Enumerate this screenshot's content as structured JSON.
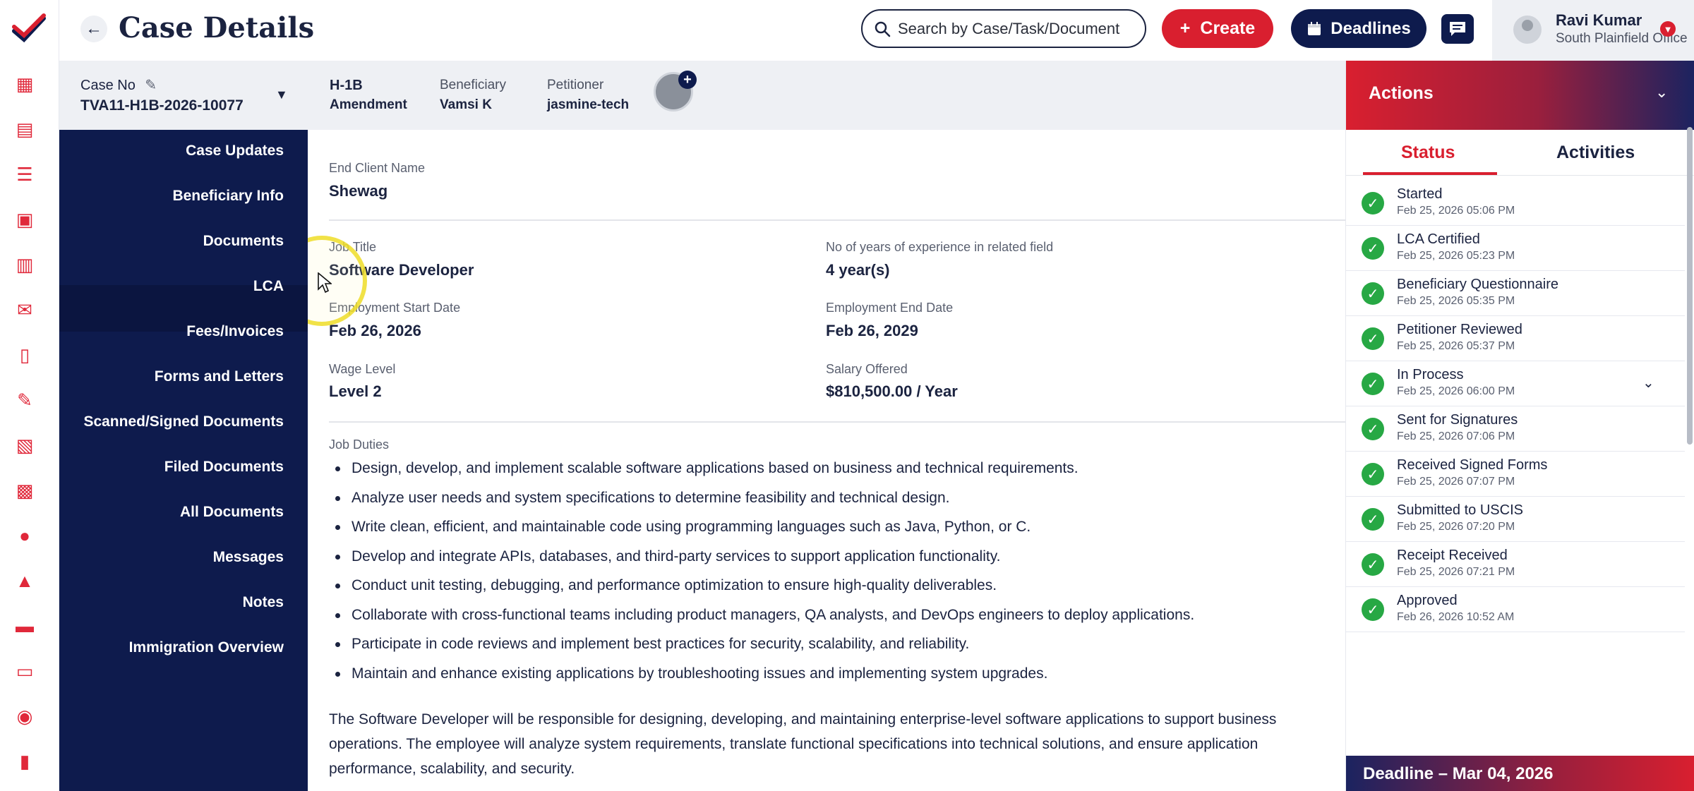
{
  "header": {
    "back_icon": "arrow-left-icon",
    "title": "Case Details",
    "search_placeholder": "Search by Case/Task/Document",
    "create_label": "Create",
    "deadlines_label": "Deadlines",
    "user_name": "Ravi Kumar",
    "user_office": "South Plainfield Office"
  },
  "rail": {
    "icons": [
      "dashboard-icon",
      "cases-icon",
      "tasks-icon",
      "calendar-icon",
      "forms-icon",
      "messages-icon",
      "documents-icon",
      "edit-icon",
      "reports-icon",
      "clipboard-icon",
      "user-icon",
      "people-icon",
      "folder-icon",
      "notes-icon",
      "contacts-icon",
      "book-icon"
    ]
  },
  "case": {
    "case_no_label": "Case No",
    "case_no": "TVA11-H1B-2026-10077",
    "visa_type": "H-1B",
    "case_type": "Amendment",
    "beneficiary_label": "Beneficiary",
    "beneficiary": "Vamsi K",
    "petitioner_label": "Petitioner",
    "petitioner": "jasmine-tech"
  },
  "subnav": {
    "items": [
      "Case Updates",
      "Beneficiary Info",
      "Documents",
      "LCA",
      "Fees/Invoices",
      "Forms and Letters",
      "Scanned/Signed Documents",
      "Filed Documents",
      "All Documents",
      "Messages",
      "Notes",
      "Immigration Overview"
    ],
    "active": "LCA"
  },
  "details": {
    "end_client_label": "End Client Name",
    "end_client": "Shewag",
    "job_title_label": "Job Title",
    "job_title": "Software Developer",
    "experience_label": "No of years of experience in related field",
    "experience": "4 year(s)",
    "start_label": "Employment Start Date",
    "start": "Feb 26, 2026",
    "end_label": "Employment End Date",
    "end": "Feb 26, 2029",
    "wage_label": "Wage Level",
    "wage": "Level 2",
    "salary_label": "Salary Offered",
    "salary": "$810,500.00 / Year",
    "duties_label": "Job Duties",
    "duties": [
      "Design, develop, and implement scalable software applications based on business and technical requirements.",
      "Analyze user needs and system specifications to determine feasibility and technical design.",
      "Write clean, efficient, and maintainable code using programming languages such as Java, Python, or C.",
      "Develop and integrate APIs, databases, and third-party services to support application functionality.",
      "Conduct unit testing, debugging, and performance optimization to ensure high-quality deliverables.",
      "Collaborate with cross-functional teams including product managers, QA analysts, and DevOps engineers to deploy applications.",
      "Participate in code reviews and implement best practices for security, scalability, and reliability.",
      "Maintain and enhance existing applications by troubleshooting issues and implementing system upgrades."
    ],
    "summary": "The Software Developer will be responsible for designing, developing, and maintaining enterprise-level software applications to support business operations. The employee will analyze system requirements, translate functional specifications into technical solutions, and ensure application performance, scalability, and security."
  },
  "actions": {
    "title": "Actions",
    "tab_status": "Status",
    "tab_activities": "Activities",
    "statuses": [
      {
        "name": "Started",
        "date": "Feb 25, 2026 05:06 PM"
      },
      {
        "name": "LCA Certified",
        "date": "Feb 25, 2026 05:23 PM"
      },
      {
        "name": "Beneficiary Questionnaire",
        "date": "Feb 25, 2026 05:35 PM"
      },
      {
        "name": "Petitioner Reviewed",
        "date": "Feb 25, 2026 05:37 PM"
      },
      {
        "name": "In Process",
        "date": "Feb 25, 2026 06:00 PM"
      },
      {
        "name": "Sent for Signatures",
        "date": "Feb 25, 2026 07:06 PM"
      },
      {
        "name": "Received Signed Forms",
        "date": "Feb 25, 2026 07:07 PM"
      },
      {
        "name": "Submitted to USCIS",
        "date": "Feb 25, 2026 07:20 PM"
      },
      {
        "name": "Receipt Received",
        "date": "Feb 25, 2026 07:21 PM"
      },
      {
        "name": "Approved",
        "date": "Feb 26, 2026 10:52 AM"
      }
    ],
    "deadline": "Deadline – Mar 04, 2026"
  },
  "colors": {
    "brand_red": "#d91f2f",
    "navy": "#0e1b4d",
    "status_green": "#27a844"
  }
}
